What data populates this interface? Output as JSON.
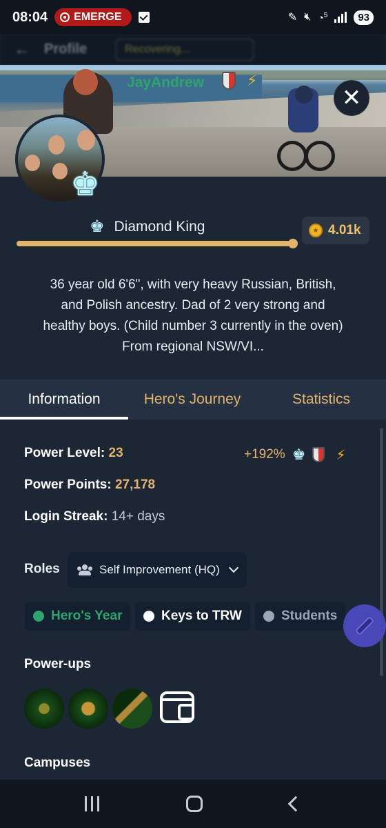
{
  "status_bar": {
    "time": "08:04",
    "emergency_label": "EMERGE",
    "battery": "93",
    "network": "5"
  },
  "header": {
    "title": "Profile",
    "recovering_label": "Recovering..."
  },
  "profile": {
    "username": "JayAndrew",
    "rank_name": "Diamond King",
    "rank_progress": 0.99,
    "coins": "4.01k",
    "bio": "36 year old 6'6\", with very heavy Russian, British, and Polish ancestry. Dad of 2 very strong and healthy boys. (Child number 3 currently in the oven) From regional NSW/VI..."
  },
  "tabs": [
    {
      "label": "Information",
      "active": true
    },
    {
      "label": "Hero's Journey",
      "active": false
    },
    {
      "label": "Statistics",
      "active": false
    }
  ],
  "info": {
    "power_level_label": "Power Level",
    "power_level_value": "23",
    "boost": "+192%",
    "power_points_label": "Power Points",
    "power_points_value": "27,178",
    "login_streak_label": "Login Streak",
    "login_streak_value": "14+ days",
    "roles_label": "Roles",
    "roles_selected": "Self Improvement (HQ)",
    "chips": [
      {
        "label": "Hero's Year",
        "color": "#2ea46e",
        "text_color": "#2ea46e"
      },
      {
        "label": "Keys to TRW",
        "color": "#ffffff",
        "text_color": "#ffffff"
      },
      {
        "label": "Students",
        "color": "#9aa7b5",
        "text_color": "#9aa7b5"
      }
    ],
    "powerups_label": "Power-ups",
    "campuses_label": "Campuses"
  },
  "colors": {
    "accent_gold": "#e2b46a",
    "background": "#1c2634",
    "diamond": "#bdf3ff"
  },
  "icons": {
    "close": "close-icon",
    "king": "chess-king-icon",
    "coin": "coin-icon",
    "edit_fab": "pen-icon",
    "wallet": "wallet-icon"
  }
}
